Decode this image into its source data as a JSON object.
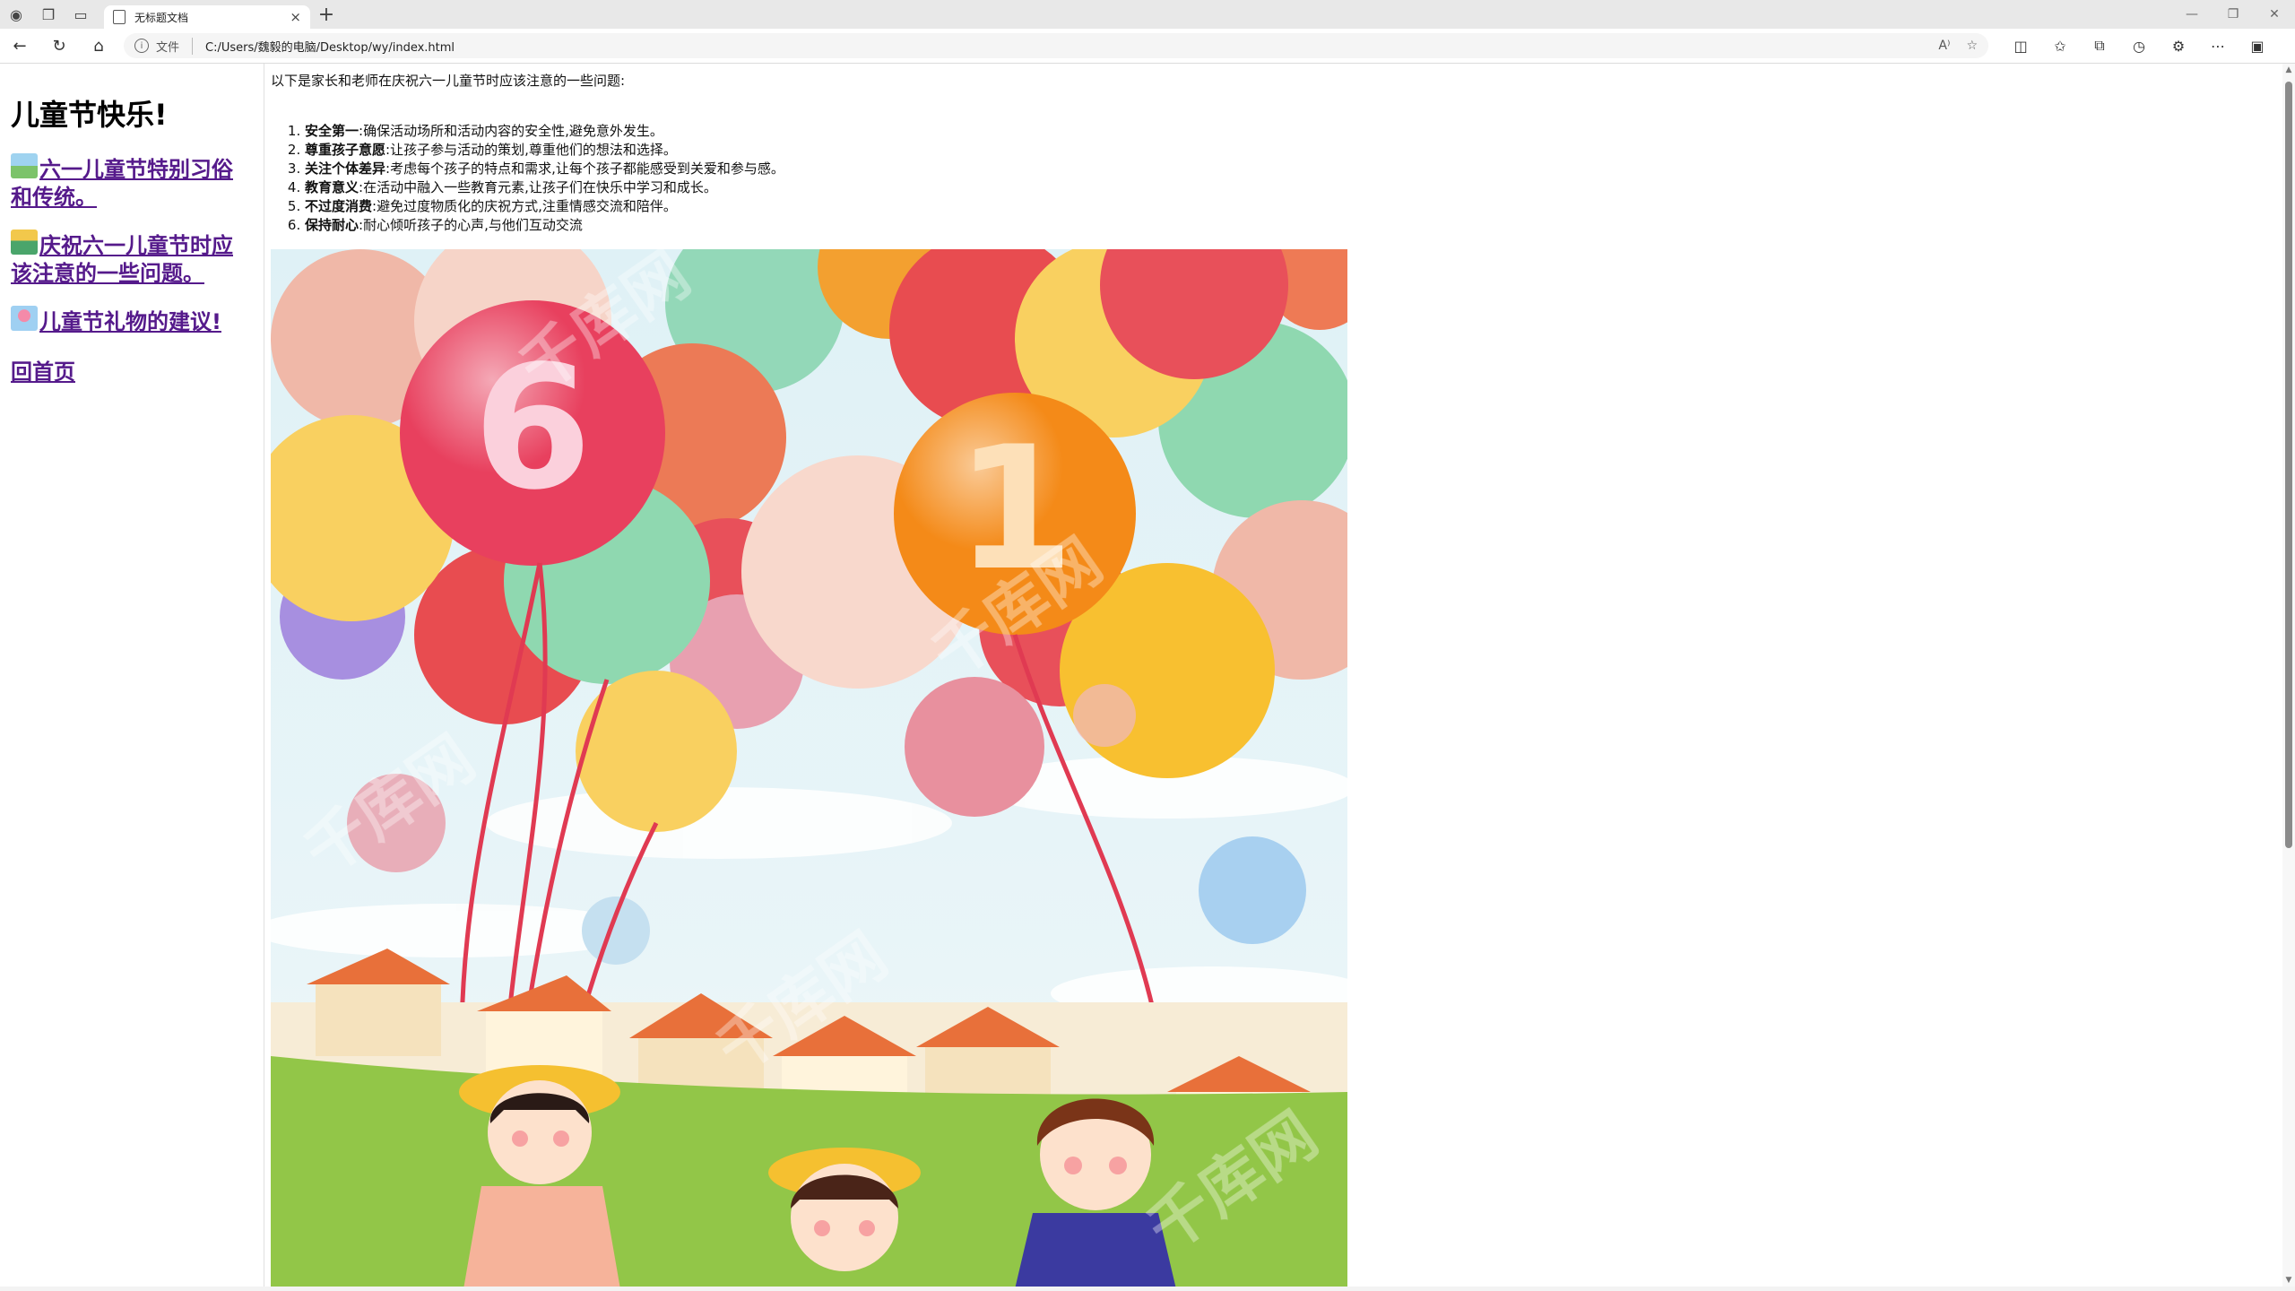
{
  "browser": {
    "tab_title": "无标题文档",
    "new_tab_symbol": "+",
    "close_symbol": "×",
    "scheme_label": "文件",
    "url": "C:/Users/魏毅的电脑/Desktop/wy/index.html",
    "read_aloud_label": "A⁾"
  },
  "sidebar": {
    "title": "儿童节快乐!",
    "links": [
      {
        "label": "六一儿童节特别习俗和传统。"
      },
      {
        "label": "庆祝六一儿童节时应该注意的一些问题。"
      },
      {
        "label": "儿童节礼物的建议!"
      }
    ],
    "home_label": "回首页"
  },
  "content": {
    "intro": "以下是家长和老师在庆祝六一儿童节时应该注意的一些问题:",
    "tips": [
      {
        "title": "安全第一",
        "text": ":确保活动场所和活动内容的安全性,避免意外发生。"
      },
      {
        "title": "尊重孩子意愿",
        "text": ":让孩子参与活动的策划,尊重他们的想法和选择。"
      },
      {
        "title": "关注个体差异",
        "text": ":考虑每个孩子的特点和需求,让每个孩子都能感受到关爱和参与感。"
      },
      {
        "title": "教育意义",
        "text": ":在活动中融入一些教育元素,让孩子们在快乐中学习和成长。"
      },
      {
        "title": "不过度消费",
        "text": ":避免过度物质化的庆祝方式,注重情感交流和陪伴。"
      },
      {
        "title": "保持耐心",
        "text": ":耐心倾听孩子的心声,与他们互动交流"
      }
    ]
  },
  "poster": {
    "balloon_text_left": "6",
    "balloon_text_right": "1",
    "watermark": "千库网"
  }
}
